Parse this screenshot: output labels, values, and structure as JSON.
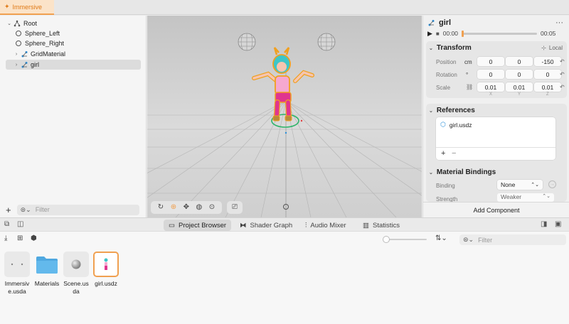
{
  "document_tab": {
    "label": "Immersive"
  },
  "hierarchy": {
    "items": [
      {
        "label": "Root",
        "icon": "entity-icon",
        "disclosure": "expanded"
      },
      {
        "label": "Sphere_Left",
        "icon": "sphere-icon"
      },
      {
        "label": "Sphere_Right",
        "icon": "sphere-icon"
      },
      {
        "label": "GridMaterial",
        "icon": "model-icon",
        "disclosure": "collapsed"
      },
      {
        "label": "girl",
        "icon": "model-icon",
        "disclosure": "collapsed",
        "selected": true
      }
    ],
    "filter_placeholder": "Filter"
  },
  "viewport": {
    "selection_ring_color": "#2fb56a",
    "outline_color": "#f0a020"
  },
  "inspector": {
    "entity_name": "girl",
    "playback": {
      "current_time": "00:00",
      "end_time": "00:05",
      "progress": 0.0
    },
    "transform": {
      "title": "Transform",
      "space": "Local",
      "position_label": "Position",
      "unit": "cm",
      "position": [
        "0",
        "0",
        "-150"
      ],
      "rotation_label": "Rotation",
      "rotation_unit": "°",
      "rotation": [
        "0",
        "0",
        "0"
      ],
      "scale_label": "Scale",
      "scale": [
        "0.01",
        "0.01",
        "0.01"
      ],
      "axes": [
        "X",
        "Y",
        "Z"
      ]
    },
    "references": {
      "title": "References",
      "items": [
        "girl.usdz"
      ]
    },
    "material_bindings": {
      "title": "Material Bindings",
      "binding_label": "Binding",
      "binding_value": "None",
      "strength_label": "Strength",
      "strength_value": "Weaker"
    },
    "add_component_label": "Add Component"
  },
  "bottom_tabs": [
    {
      "label": "Project Browser",
      "icon": "folder-icon",
      "active": true
    },
    {
      "label": "Shader Graph",
      "icon": "shader-graph-icon"
    },
    {
      "label": "Audio Mixer",
      "icon": "audio-mixer-icon"
    },
    {
      "label": "Statistics",
      "icon": "statistics-icon"
    }
  ],
  "project_browser": {
    "filter_placeholder": "Filter",
    "zoom_level": 0.0,
    "assets": [
      {
        "name": "Immersive.usda",
        "type": "scene-icon"
      },
      {
        "name": "Materials",
        "type": "folder-icon"
      },
      {
        "name": "Scene.usda",
        "type": "sphere-scene-icon"
      },
      {
        "name": "girl.usdz",
        "type": "model-icon",
        "selected": true
      }
    ]
  },
  "colors": {
    "accent": "#f0a050",
    "accent_text": "#e07a16",
    "link": "#2a8fd9"
  }
}
